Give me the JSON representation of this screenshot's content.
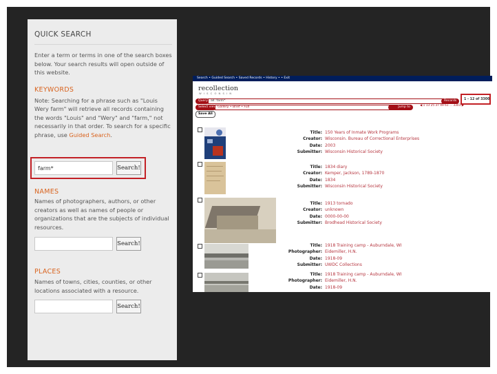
{
  "quick_search": {
    "title": "QUICK SEARCH",
    "intro": "Enter a term or terms in one of the search boxes below. Your search results will open outside of this website.",
    "keywords": {
      "heading": "KEYWORDS",
      "note_before_link": "Note: Searching for a phrase such as \"Louis Wery farm\" will retrieve all records containing the words \"Louis\" and \"Wery\" and \"farm,\" not necessarily in that order. To search for a specific phrase, use ",
      "link": "Guided Search",
      "note_after_link": ".",
      "input_value": "farm*",
      "button": "Search!"
    },
    "names": {
      "heading": "NAMES",
      "description": "Names of photographers, authors, or other creators as well as names of people or organizations that are the subjects of individual resources.",
      "input_value": "",
      "button": "Search!"
    },
    "places": {
      "heading": "PLACES",
      "description": "Names of towns, cities, counties, or other locations associated with a resource.",
      "input_value": "",
      "button": "Search!"
    }
  },
  "recollection": {
    "nav": "Search  •  Guided Search  •  Saved Records  •  History  •  •  Exit",
    "logo": "recollection",
    "logo_sub": "WISCONSIN",
    "query_label": "Query",
    "query_value": "all: farm*",
    "records_label": "Records",
    "records_value": "1 - 12 of 3300",
    "select_view_label": "Select view",
    "view_options": "Gallery  •  Brief  •  Full",
    "jump_to_label": "Jump to",
    "pager": "◀ 1 13 25 37 49 61 ... 3301 ▶",
    "save_all": "Save All",
    "records": [
      {
        "fields": [
          [
            "Title:",
            "150 Years of Inmate Work Programs"
          ],
          [
            "Creator:",
            "Wisconsin. Bureau of Correctional Enterprises"
          ],
          [
            "Date:",
            "2003"
          ],
          [
            "Submitter:",
            "Wisconsin Historical Society"
          ]
        ]
      },
      {
        "fields": [
          [
            "Title:",
            "1834 diary"
          ],
          [
            "Creator:",
            "Kemper, Jackson, 1789-1870"
          ],
          [
            "Date:",
            "1834"
          ],
          [
            "Submitter:",
            "Wisconsin Historical Society"
          ]
        ]
      },
      {
        "fields": [
          [
            "Title:",
            "1913 tornado"
          ],
          [
            "Creator:",
            "unknown"
          ],
          [
            "Date:",
            "0000-00-00"
          ],
          [
            "Submitter:",
            "Brodhead Historical Society"
          ]
        ]
      },
      {
        "fields": [
          [
            "Title:",
            "1918 Training camp - Auburndale, WI"
          ],
          [
            "Photographer:",
            "Eidemiller, H.N."
          ],
          [
            "Date:",
            "1918-09"
          ],
          [
            "Submitter:",
            "UWDC Collections"
          ]
        ]
      },
      {
        "fields": [
          [
            "Title:",
            "1918 Training camp - Auburndale, WI"
          ],
          [
            "Photographer:",
            "Eidemiller, H.N."
          ],
          [
            "Date:",
            "1918-09"
          ]
        ]
      }
    ]
  }
}
